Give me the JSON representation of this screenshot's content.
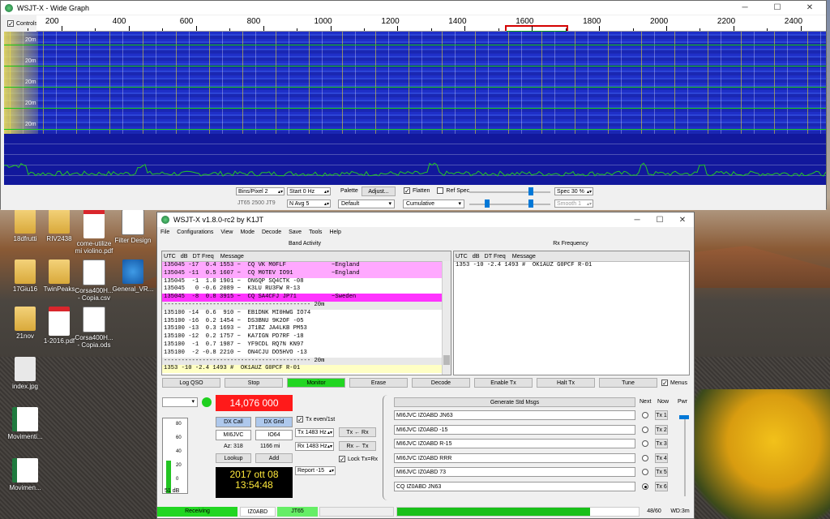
{
  "wide_graph": {
    "title": "WSJT-X - Wide Graph",
    "controls_label": "Controls",
    "scale_ticks": [
      "200",
      "400",
      "600",
      "800",
      "1000",
      "1200",
      "1400",
      "1600",
      "1800",
      "2000",
      "2200",
      "2400"
    ],
    "band_labels": [
      "20m",
      "20m",
      "20m",
      "20m",
      "20m"
    ],
    "bins_label": "Bins/Pixel 2",
    "start_label": "Start 0 Hz",
    "mode_hint": "JT65  2500  JT9",
    "navg_label": "N Avg 5",
    "palette_label": "Palette",
    "adjust_label": "Adjust...",
    "palette_value": "Default",
    "flatten_label": "Flatten",
    "refspec_label": "Ref Spec",
    "cumulative_value": "Cumulative",
    "spec_label": "Spec 30 %",
    "smooth_label": "Smooth 1"
  },
  "desktop_icons": [
    {
      "label": "18dfrutti",
      "type": "folder"
    },
    {
      "label": "RIV2438",
      "type": "folder"
    },
    {
      "label": "come-utilize mi violino.pdf",
      "type": "pdf"
    },
    {
      "label": "Filter Design",
      "type": "file"
    },
    {
      "label": "17Giu16",
      "type": "folder"
    },
    {
      "label": "TwinPeaks",
      "type": "folder"
    },
    {
      "label": "Corsa400H... - Copia.csv",
      "type": "ods"
    },
    {
      "label": "General_VR...",
      "type": "ie"
    },
    {
      "label": "21nov",
      "type": "folder"
    },
    {
      "label": "1-2016.pdf",
      "type": "pdf"
    },
    {
      "label": "Corsa400H... - Copia.ods",
      "type": "file"
    },
    {
      "label": "index.jpg",
      "type": "jpg"
    },
    {
      "label": "Movimenti...",
      "type": "xls"
    },
    {
      "label": "Movimen...",
      "type": "xls"
    }
  ],
  "main": {
    "title": "WSJT-X   v1.8.0-rc2   by K1JT",
    "menu": [
      "File",
      "Configurations",
      "View",
      "Mode",
      "Decode",
      "Save",
      "Tools",
      "Help"
    ],
    "band_activity_title": "Band Activity",
    "rx_frequency_title": "Rx Frequency",
    "band_header": "UTC   dB   DT Freq    Message",
    "rx_header": "UTC   dB   DT Freq    Message",
    "band_rows": [
      {
        "text": "135045 -17  0.4 1553 ~  CQ VK M0FLF             ~England",
        "style": "pink"
      },
      {
        "text": "135045 -11  0.5 1607 ~  CQ M0TEV IO91           ~England",
        "style": "pink"
      },
      {
        "text": "135045  -1  1.0 1901 ~  ON6QP SQ4CTK -08",
        "style": ""
      },
      {
        "text": "135045   0 -0.6 2089 ~  K3LU RU3FW R-13",
        "style": ""
      },
      {
        "text": "135045  -8  0.8 3915 ~  CQ SA4CFJ JP71          ~Sweden",
        "style": "mag"
      },
      {
        "text": "------------------------------------------ 20m",
        "style": "sep"
      },
      {
        "text": "135100 -14  0.6  910 ~  EB1DNK MI0HWG IO74",
        "style": ""
      },
      {
        "text": "135100 -16  0.2 1454 ~  DS3BNU 9K2OF -05",
        "style": ""
      },
      {
        "text": "135100 -13  0.3 1693 ~  JT1BZ JA4LKB PM53",
        "style": ""
      },
      {
        "text": "135100 -12  0.2 1757 ~  KA7IGN PD7RF -18",
        "style": ""
      },
      {
        "text": "135100  -1  0.7 1987 ~  YF9CDL RQ7N KN97",
        "style": ""
      },
      {
        "text": "135100  -2 -0.8 2210 ~  ON4CJU DO5HVO -13",
        "style": ""
      },
      {
        "text": "------------------------------------------ 20m",
        "style": "sep"
      },
      {
        "text": "1353 -10 -2.4 1493 #  OK1AUZ G0PCF R-01",
        "style": "last"
      }
    ],
    "rx_rows": [
      "1353 -10 -2.4 1493 #  OK1AUZ G0PCF R-01"
    ],
    "buttons": {
      "log_qso": "Log QSO",
      "stop": "Stop",
      "monitor": "Monitor",
      "erase": "Erase",
      "decode": "Decode",
      "enable_tx": "Enable Tx",
      "halt_tx": "Halt Tx",
      "tune": "Tune",
      "menus": "Menus"
    },
    "frequency": "14,076 000",
    "dx_call_label": "DX Call",
    "dx_grid_label": "DX Grid",
    "dx_call": "MI6JVC",
    "dx_grid": "IO64",
    "az": "Az: 318",
    "distance": "1166 mi",
    "lookup_label": "Lookup",
    "add_label": "Add",
    "tx_even_label": "Tx even/1st",
    "tx_freq": "Tx  1483 Hz",
    "rx_freq": "Rx  1483 Hz",
    "tx_from_rx": "Tx ← Rx",
    "rx_from_tx": "Rx ← Tx",
    "lock_label": "Lock Tx=Rx",
    "report": "Report -15",
    "date": "2017 ott 08",
    "time": "13:54:48",
    "meter_ticks": [
      "80",
      "60",
      "40",
      "20",
      "0"
    ],
    "meter_level": "51 dB",
    "meter_fill_fraction": 0.45,
    "gen_std_msgs": "Generate Std Msgs",
    "next_label": "Next",
    "now_label": "Now",
    "pwr_label": "Pwr",
    "messages": [
      {
        "text": "MI6JVC IZ0ABD JN63",
        "tx": "Tx 1",
        "selected": false
      },
      {
        "text": "MI6JVC IZ0ABD -15",
        "tx": "Tx 2",
        "selected": false
      },
      {
        "text": "MI6JVC IZ0ABD R-15",
        "tx": "Tx 3",
        "selected": false
      },
      {
        "text": "MI6JVC IZ0ABD RRR",
        "tx": "Tx 4",
        "selected": false
      },
      {
        "text": "MI6JVC IZ0ABD 73",
        "tx": "Tx 5",
        "selected": false
      },
      {
        "text": "CQ IZ0ABD JN63",
        "tx": "Tx 6",
        "selected": true
      }
    ],
    "status": {
      "receiving": "Receiving",
      "mycall": "IZ0ABD",
      "mode": "JT65",
      "progress": "48/60",
      "progress_fraction": 0.8,
      "wd": "WD:3m"
    }
  },
  "colors": {
    "waterfall": "#1f2fc8",
    "decode_pink": "#ffa8ff",
    "decode_magenta": "#ff33ff",
    "freq_red": "#ff1a1a",
    "monitor_green": "#22d622",
    "spectrum_line": "#23c823"
  }
}
